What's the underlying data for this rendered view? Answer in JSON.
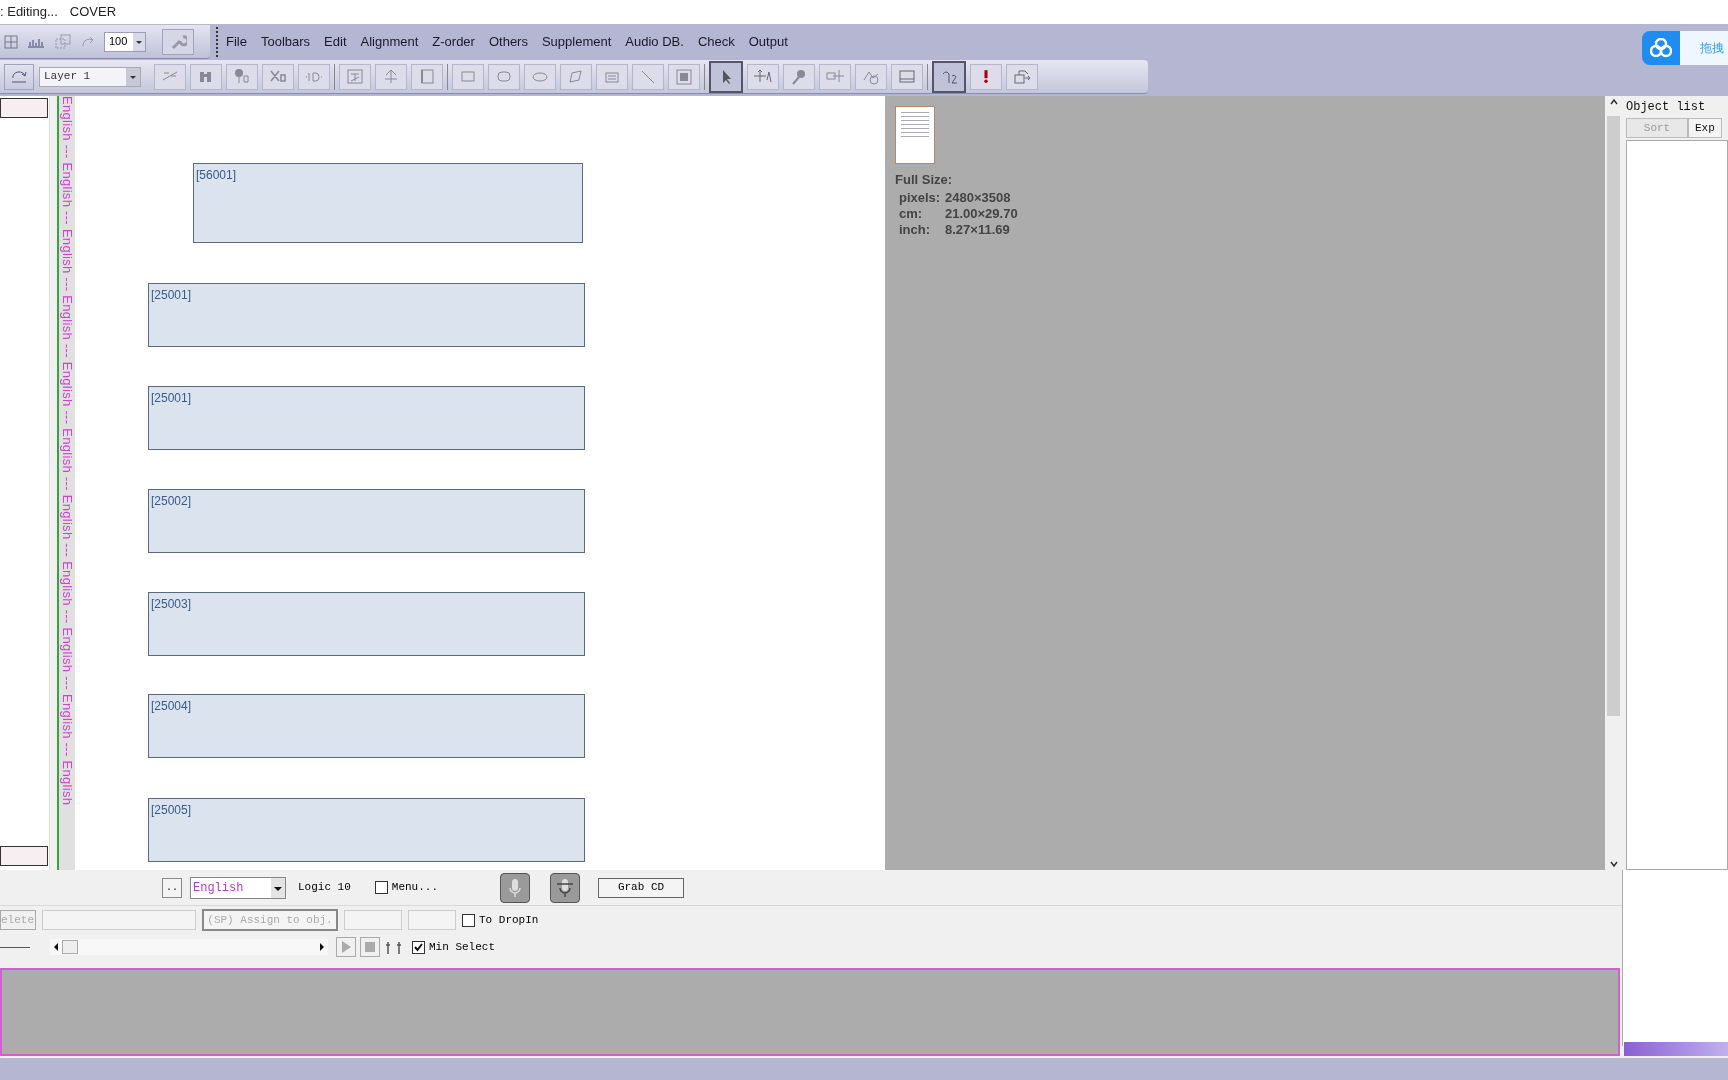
{
  "title_bar": {
    "status": ": Editing...",
    "document": "COVER"
  },
  "zoom": {
    "value": "100"
  },
  "menu": [
    "File",
    "Toolbars",
    "Edit",
    "Alignment",
    "Z-order",
    "Others",
    "Supplement",
    "Audio DB.",
    "Check",
    "Output"
  ],
  "layer": {
    "value": "Layer 1"
  },
  "tools": [
    {
      "selected": false
    },
    {
      "selected": false
    },
    {
      "selected": false
    },
    {
      "selected": false
    },
    {
      "selected": false
    },
    {
      "selected": false
    },
    {
      "selected": false
    },
    {
      "selected": false
    },
    {
      "selected": false
    },
    {
      "selected": false
    },
    {
      "selected": false
    },
    {
      "selected": false
    },
    {
      "selected": false
    },
    {
      "selected": false
    },
    {
      "selected": false
    },
    {
      "selected": true
    },
    {
      "selected": false
    },
    {
      "selected": false
    },
    {
      "selected": false
    },
    {
      "selected": false
    },
    {
      "selected": false
    },
    {
      "selected": true
    },
    {
      "selected": false
    },
    {
      "selected": false
    }
  ],
  "cloud_widget": {
    "label": "拖拽"
  },
  "language_strip": {
    "text": "English --- English --- English --- English --- English --- English --- English --- English --- English --- English --- English"
  },
  "frames": [
    {
      "label": "[56001]"
    },
    {
      "label": "[25001]"
    },
    {
      "label": "[25001]"
    },
    {
      "label": "[25002]"
    },
    {
      "label": "[25003]"
    },
    {
      "label": "[25004]"
    },
    {
      "label": "[25005]"
    }
  ],
  "preview": {
    "heading": "Full Size:",
    "lines": [
      {
        "label": "pixels:",
        "value": "2480×3508"
      },
      {
        "label": "cm:",
        "value": "21.00×29.70"
      },
      {
        "label": "inch:",
        "value": "8.27×11.69"
      }
    ]
  },
  "object_list": {
    "title": "Object list",
    "buttons": [
      {
        "label": "Sort",
        "disabled": true
      },
      {
        "label": "Exp",
        "disabled": false
      }
    ]
  },
  "controls": {
    "more_button": "..",
    "language": "English",
    "logic": "Logic 10",
    "menu_checkbox": {
      "label": "Menu...",
      "checked": false
    },
    "grab_button": "Grab CD",
    "delete_button": {
      "label": "elete",
      "disabled": true
    },
    "assign_button": {
      "label": "(SP) Assign to obj.",
      "disabled": true
    },
    "dropin_checkbox": {
      "label": "To DropIn",
      "checked": false
    },
    "min_select_checkbox": {
      "label": "Min Select",
      "checked": true
    }
  }
}
